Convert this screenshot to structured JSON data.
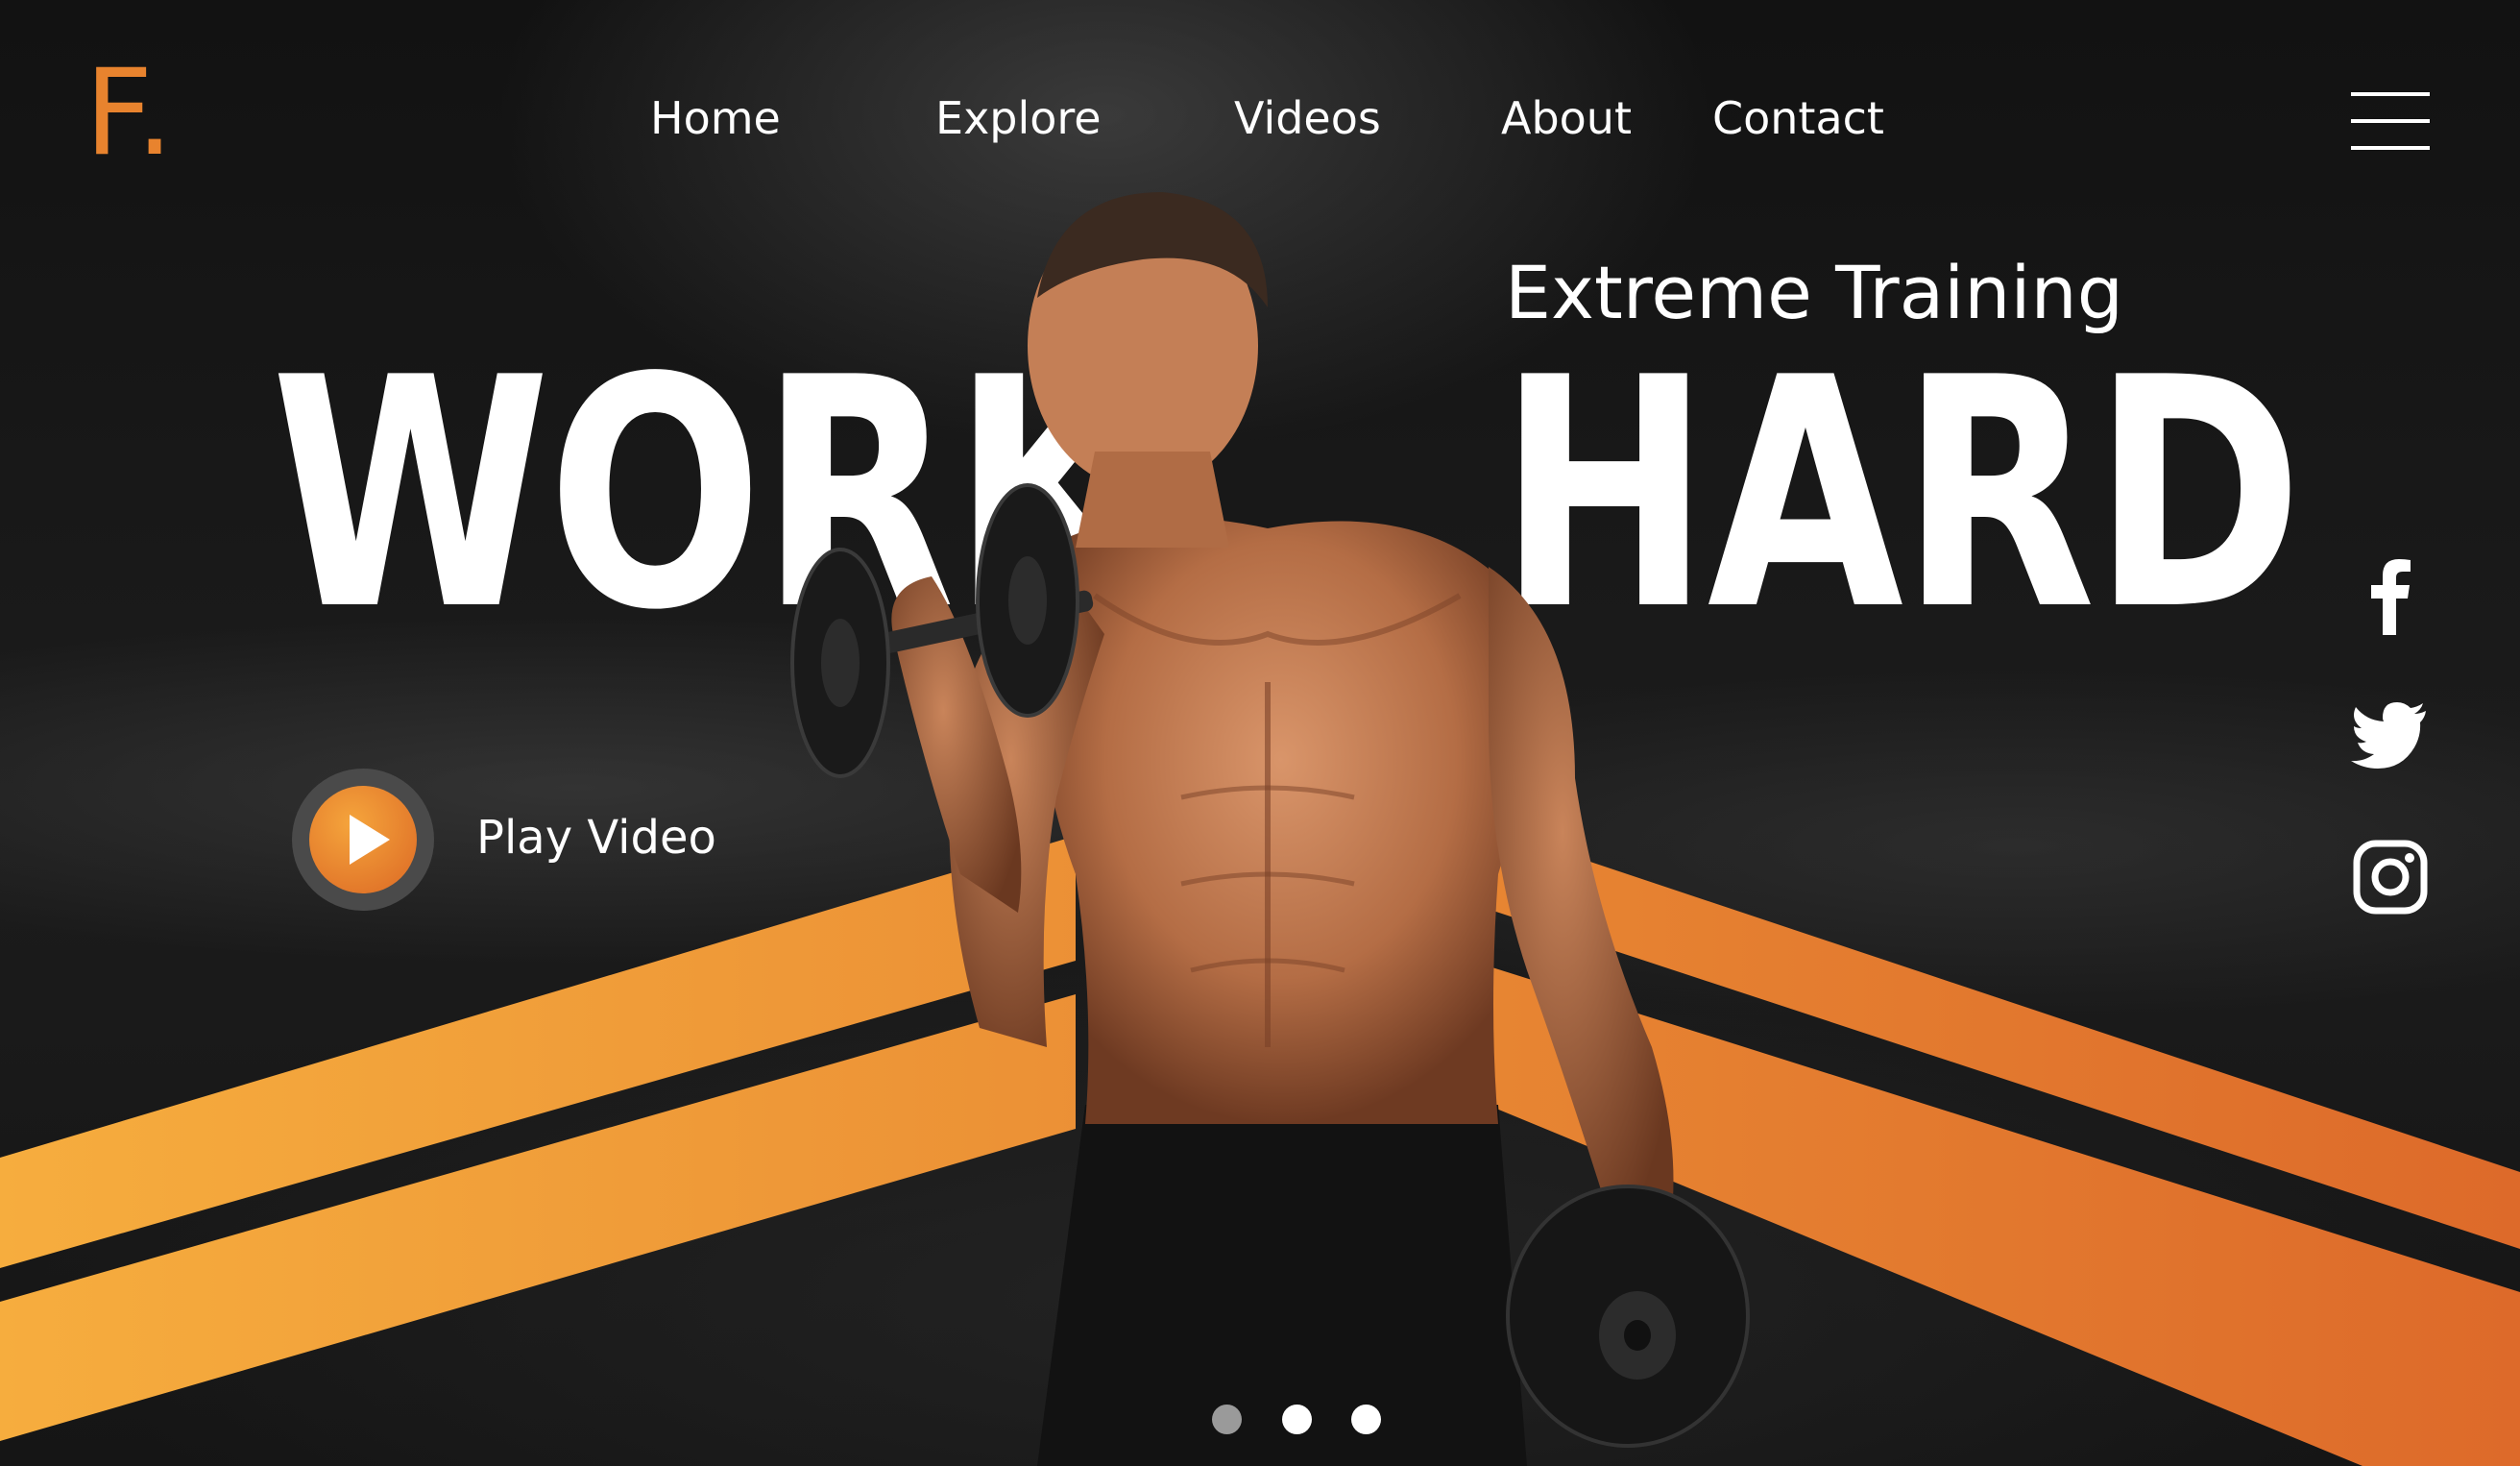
{
  "brand": {
    "logo": "F.",
    "accent_color": "#e8832e"
  },
  "nav": {
    "items": [
      {
        "label": "Home"
      },
      {
        "label": "Explore"
      },
      {
        "label": "Videos"
      },
      {
        "label": "About"
      },
      {
        "label": "Contact"
      }
    ],
    "menu_icon": "hamburger-menu-icon"
  },
  "hero": {
    "tagline": "Extreme Training",
    "word_left": "WORK",
    "word_right": "HARD",
    "image": "athlete-with-dumbbells"
  },
  "play_video": {
    "label": "Play Video",
    "icon": "play-icon"
  },
  "social": [
    {
      "icon": "facebook-icon"
    },
    {
      "icon": "twitter-icon"
    },
    {
      "icon": "instagram-icon"
    }
  ],
  "carousel": {
    "slide_count": 3,
    "active_index": 0
  },
  "colors": {
    "stripe_start": "#f6ad3e",
    "stripe_end": "#dd6a2a",
    "background": "#121212"
  }
}
